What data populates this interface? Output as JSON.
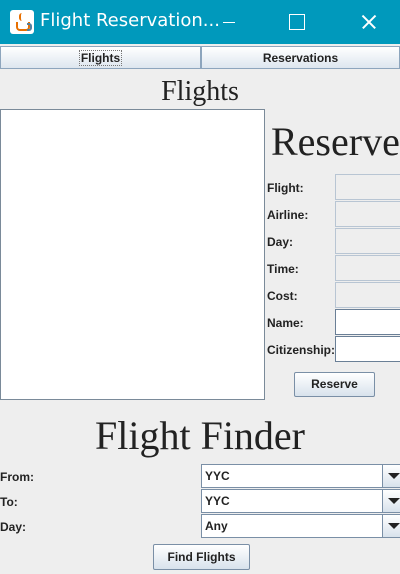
{
  "window": {
    "title": "Flight Reservation..."
  },
  "tabs": [
    {
      "label": "Flights"
    },
    {
      "label": "Reservations"
    }
  ],
  "flights_panel": {
    "heading": "Flights"
  },
  "reserve_panel": {
    "heading": "Reserve",
    "fields": [
      {
        "label": "Flight:",
        "value": ""
      },
      {
        "label": "Airline:",
        "value": ""
      },
      {
        "label": "Day:",
        "value": ""
      },
      {
        "label": "Time:",
        "value": ""
      },
      {
        "label": "Cost:",
        "value": ""
      },
      {
        "label": "Name:",
        "value": ""
      },
      {
        "label": "Citizenship:",
        "value": ""
      }
    ],
    "button_label": "Reserve"
  },
  "finder": {
    "heading": "Flight Finder",
    "from": {
      "label": "From:",
      "value": "YYC"
    },
    "to": {
      "label": "To:",
      "value": "YYC"
    },
    "day": {
      "label": "Day:",
      "value": "Any"
    },
    "button_label": "Find Flights"
  },
  "icons": {
    "app": "java-cup-icon",
    "minimize": "minimize-icon",
    "maximize": "maximize-icon",
    "close": "close-icon",
    "dropdown": "chevron-down-icon"
  },
  "colors": {
    "titlebar": "#0099bc",
    "background": "#eeeeee"
  }
}
